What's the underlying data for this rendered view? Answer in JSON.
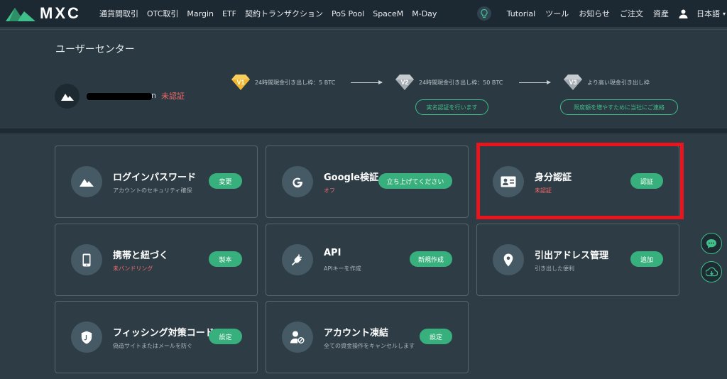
{
  "brand": {
    "name": "MXC",
    "accent": "#38b07d",
    "alert": "#f46a6a"
  },
  "nav": {
    "left": [
      "通貨間取引",
      "OTC取引",
      "Margin",
      "ETF",
      "契約トランザクション",
      "PoS Pool",
      "SpaceM",
      "M-Day"
    ],
    "right": [
      "Tutorial",
      "ツール",
      "お知らせ",
      "ご注文",
      "資産"
    ],
    "language": "日本語"
  },
  "header": {
    "title": "ユーザーセンター",
    "username_tail": "n",
    "status": "未認証",
    "levels": [
      {
        "badge": "V1",
        "desc": "24時間現金引き出し枠：5 BTC"
      },
      {
        "badge": "V2",
        "desc": "24時間現金引き出し枠：50 BTC"
      },
      {
        "badge": "V3",
        "desc": "より高い現金引き出し枠"
      }
    ],
    "actions": [
      "実名認証を行います",
      "限度額を増やすために当社にご連絡"
    ]
  },
  "cards": [
    {
      "title": "ログインパスワード",
      "sub": "アカウントのセキュリティ確保",
      "button": "変更",
      "icon": "mountain-icon"
    },
    {
      "title": "Google検証",
      "sub": "オフ",
      "button": "立ち上げてください",
      "icon": "google-icon"
    },
    {
      "title": "身分認証",
      "sub": "未認証",
      "button": "認証",
      "icon": "id-card-icon"
    },
    {
      "title": "携帯と紐づく",
      "sub": "未バンドリング",
      "button": "製本",
      "icon": "phone-icon"
    },
    {
      "title": "API",
      "sub": "APIキーを作成",
      "button": "新規作成",
      "icon": "plug-icon"
    },
    {
      "title": "引出アドレス管理",
      "sub": "引き出した便利",
      "button": "追加",
      "icon": "location-icon"
    },
    {
      "title": "フィッシング対策コード",
      "sub": "偽造サイトまたはメールを防ぐ",
      "button": "設定",
      "icon": "shield-icon"
    },
    {
      "title": "アカウント凍結",
      "sub": "全ての資金操作をキャンセルします",
      "button": "設定",
      "icon": "user-block-icon"
    }
  ]
}
